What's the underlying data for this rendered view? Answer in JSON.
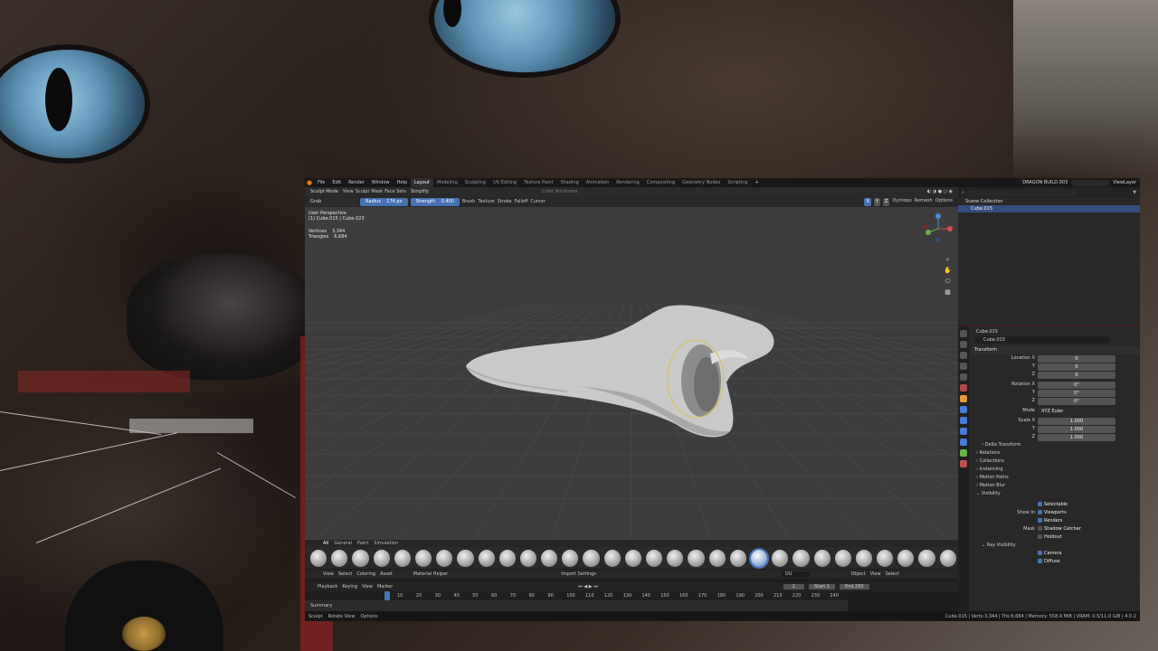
{
  "blender": {
    "menu": [
      "File",
      "Edit",
      "Render",
      "Window",
      "Help"
    ],
    "workspaces": [
      "Layout",
      "Modeling",
      "Sculpting",
      "UV Editing",
      "Texture Paint",
      "Shading",
      "Animation",
      "Rendering",
      "Compositing",
      "Geometry Nodes",
      "Scripting"
    ],
    "active_workspace": "Layout",
    "file_name": "DRAGON BUILD.003",
    "view_layer": "ViewLayer",
    "viewport_header": {
      "mode": "Sculpt Mode",
      "menus": [
        "View",
        "Sculpt",
        "Mask",
        "Face Sets"
      ],
      "simplify": "Simplify",
      "color_attributes": "Color Attributes"
    },
    "tool_header": {
      "brush": "Grab",
      "radius_label": "Radius",
      "radius_value": "174 px",
      "strength_label": "Strength",
      "strength_value": "0.400",
      "menus": [
        "Brush",
        "Texture",
        "Stroke",
        "Falloff",
        "Cursor"
      ],
      "right": [
        "X",
        "Y",
        "Z",
        "Dyntopo",
        "Remesh",
        "Options"
      ]
    },
    "viewport_info": {
      "perspective": "User Perspective",
      "object": "(1) Cube.015 | Cube.023",
      "vertices_label": "Vertices",
      "vertices_value": "3,344",
      "triangles_label": "Triangles",
      "triangles_value": "6,684"
    },
    "brush_tabs": [
      "All",
      "General",
      "Paint",
      "Simulation"
    ],
    "brush_count": 31,
    "active_brush_index": 21,
    "timeline_editor": {
      "menus": [
        "View",
        "Select",
        "Coloring",
        "Asset"
      ],
      "material_helper": "Material Helper",
      "import_settings": "Import Settings",
      "search_value": "DU",
      "object_menu": [
        "Object",
        "View",
        "Select"
      ]
    },
    "timeline": {
      "menus": [
        "Playback",
        "Keying",
        "View",
        "Marker"
      ],
      "current_frame": "1",
      "start_label": "Start",
      "start_value": "1",
      "end_label": "End",
      "end_value": "250",
      "ticks": [
        "10",
        "20",
        "30",
        "40",
        "50",
        "60",
        "70",
        "80",
        "90",
        "100",
        "110",
        "120",
        "130",
        "140",
        "150",
        "160",
        "170",
        "180",
        "190",
        "200",
        "210",
        "220",
        "230",
        "240"
      ],
      "summary": "Summary"
    },
    "statusbar": {
      "items": [
        "Sculpt",
        "Rotate View",
        "Options"
      ],
      "right": "Cube.015 | Verts:3,344 | Tris:6,684 | Memory: 558.4 MiB | VRAM: 0.5/11.0 GiB | 4.0.2"
    },
    "outliner": {
      "scene_collection": "Scene Collection",
      "selected_item": "Cube.015"
    },
    "properties": {
      "object_name": "Cube.015",
      "object_field": "Cube.015",
      "transform_header": "Transform",
      "location": {
        "label": "Location X",
        "x": "0",
        "y": "0",
        "z": "0"
      },
      "rotation": {
        "label": "Rotation X",
        "x": "0°",
        "y": "0°",
        "z": "0°"
      },
      "mode_label": "Mode",
      "mode_value": "XYZ Euler",
      "scale": {
        "label": "Scale X",
        "x": "1.000",
        "y": "1.000",
        "z": "1.000"
      },
      "axis_y": "Y",
      "axis_z": "Z",
      "delta_transform": "Delta Transform",
      "sections": [
        "Relations",
        "Collections",
        "Instancing",
        "Motion Paths",
        "Motion Blur",
        "Visibility"
      ],
      "visibility": {
        "selectable": "Selectable",
        "show_in_label": "Show In",
        "viewports": "Viewports",
        "renders": "Renders",
        "mask_label": "Mask",
        "shadow_catcher": "Shadow Catcher",
        "holdout": "Holdout",
        "ray_visibility": "Ray Visibility",
        "camera": "Camera",
        "diffuse": "Diffuse"
      }
    }
  },
  "colors": {
    "accent": "#4772b3",
    "blender_orange": "#e87d0d",
    "viewport_bg": "#3d3d3d",
    "brush_circle": "#d4c34a"
  }
}
